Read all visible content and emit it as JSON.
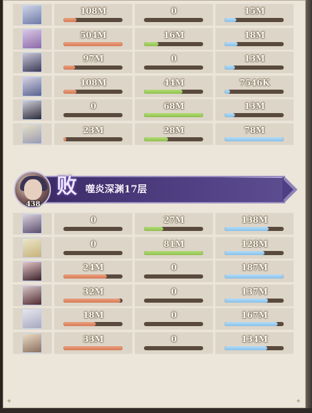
{
  "team1": {
    "rows": [
      {
        "avatar_level": "",
        "damage": "108M",
        "damage_fill": 0.22,
        "tank": "0",
        "tank_fill": 0.0,
        "heal": "15M",
        "heal_fill": 0.2
      },
      {
        "avatar_level": "",
        "damage": "504M",
        "damage_fill": 1.0,
        "tank": "16M",
        "tank_fill": 0.24,
        "heal": "18M",
        "heal_fill": 0.22
      },
      {
        "avatar_level": "",
        "damage": "97M",
        "damage_fill": 0.2,
        "tank": "0",
        "tank_fill": 0.0,
        "heal": "13M",
        "heal_fill": 0.17
      },
      {
        "avatar_level": "",
        "damage": "108M",
        "damage_fill": 0.22,
        "tank": "44M",
        "tank_fill": 0.65,
        "heal": "7546K",
        "heal_fill": 0.09
      },
      {
        "avatar_level": "",
        "damage": "0",
        "damage_fill": 0.0,
        "tank": "68M",
        "tank_fill": 1.0,
        "heal": "13M",
        "heal_fill": 0.17
      },
      {
        "avatar_level": "",
        "damage": "23M",
        "damage_fill": 0.05,
        "tank": "28M",
        "tank_fill": 0.41,
        "heal": "78M",
        "heal_fill": 1.0
      }
    ]
  },
  "banner": {
    "hero_level": "438",
    "result": "败",
    "stage": "噬炎深渊17层"
  },
  "team2": {
    "rows": [
      {
        "avatar_level": "",
        "damage": "0",
        "damage_fill": 0.0,
        "tank": "27M",
        "tank_fill": 0.33,
        "heal": "138M",
        "heal_fill": 0.74
      },
      {
        "avatar_level": "",
        "damage": "0",
        "damage_fill": 0.0,
        "tank": "81M",
        "tank_fill": 1.0,
        "heal": "128M",
        "heal_fill": 0.68
      },
      {
        "avatar_level": "",
        "damage": "24M",
        "damage_fill": 0.73,
        "tank": "0",
        "tank_fill": 0.0,
        "heal": "187M",
        "heal_fill": 1.0
      },
      {
        "avatar_level": "",
        "damage": "32M",
        "damage_fill": 0.97,
        "tank": "0",
        "tank_fill": 0.0,
        "heal": "137M",
        "heal_fill": 0.73
      },
      {
        "avatar_level": "",
        "damage": "18M",
        "damage_fill": 0.55,
        "tank": "0",
        "tank_fill": 0.0,
        "heal": "167M",
        "heal_fill": 0.89
      },
      {
        "avatar_level": "",
        "damage": "33M",
        "damage_fill": 1.0,
        "tank": "0",
        "tank_fill": 0.0,
        "heal": "134M",
        "heal_fill": 0.72
      }
    ]
  },
  "colors": {
    "damage_bar": "#d97a56",
    "tank_bar": "#8fc04c",
    "heal_bar": "#86c0ea",
    "bar_track": "#5a4a3e",
    "banner": "#4a3a7c"
  },
  "icons": {
    "avatar": "character-portrait-icon"
  }
}
